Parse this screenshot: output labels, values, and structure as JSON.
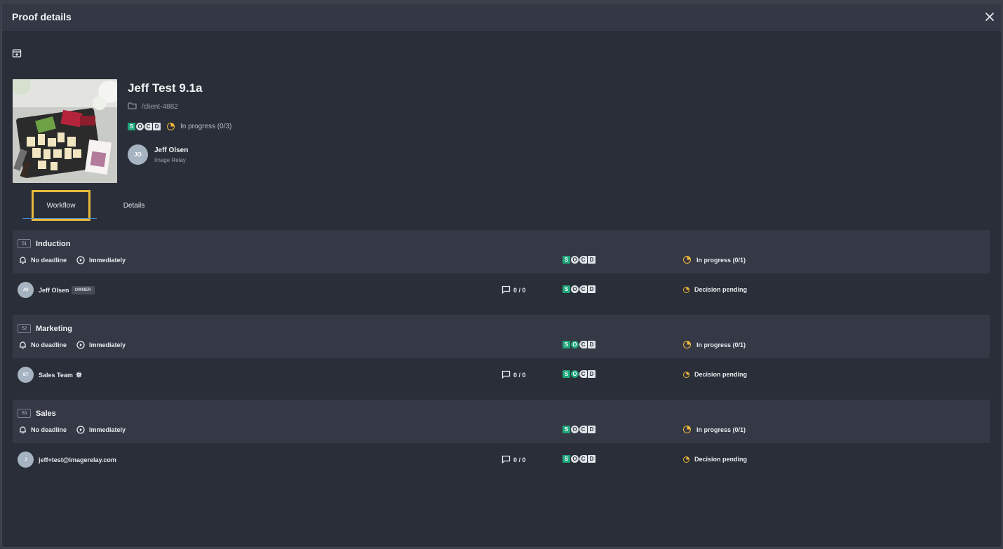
{
  "header": {
    "title": "Proof details"
  },
  "proof": {
    "name": "Jeff Test 9.1a",
    "folder": "/client-4882",
    "status": "In progress (0/3)",
    "owner": {
      "initials": "JO",
      "name": "Jeff Olsen",
      "org": "Image Relay"
    }
  },
  "tabs": [
    {
      "label": "Workflow",
      "active": true
    },
    {
      "label": "Details",
      "active": false
    }
  ],
  "colors": {
    "accent_green": "#1fa67a",
    "pending_orange": "#f0b73a",
    "tab_highlight": "#e8b93a"
  },
  "stages": [
    {
      "tag": "S1",
      "name": "Induction",
      "deadline": "No deadline",
      "start": "Immediately",
      "status": "In progress (0/1)",
      "member": {
        "initials": "JO",
        "name": "Jeff Olsen",
        "badge": "OWNER",
        "comments": "0 / 0",
        "status": "Decision pending"
      }
    },
    {
      "tag": "S2",
      "name": "Marketing",
      "deadline": "No deadline",
      "start": "Immediately",
      "status": "In progress (0/1)",
      "member": {
        "initials": "ST",
        "name": "Sales Team",
        "comments": "0 / 0",
        "status": "Decision pending"
      }
    },
    {
      "tag": "S3",
      "name": "Sales",
      "deadline": "No deadline",
      "start": "Immediately",
      "status": "In progress (0/1)",
      "member": {
        "initials": "J",
        "name": "jeff+test@imagerelay.com",
        "comments": "0 / 0",
        "status": "Decision pending"
      }
    }
  ],
  "socd_letters": [
    "S",
    "O",
    "C",
    "D"
  ]
}
